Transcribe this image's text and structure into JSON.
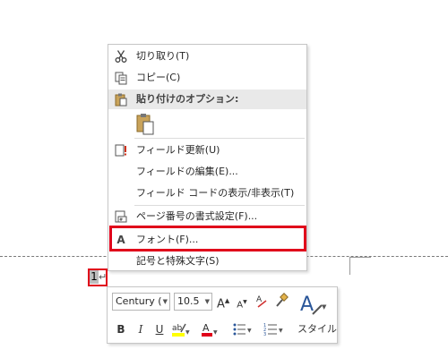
{
  "menu": {
    "items": [
      {
        "label": "切り取り(T)",
        "icon": "scissors-icon"
      },
      {
        "label": "コピー(C)",
        "icon": "copy-icon"
      },
      {
        "label": "貼り付けのオプション:",
        "icon": "paste-icon"
      },
      {
        "label": "フィールド更新(U)",
        "icon": "update-field-icon"
      },
      {
        "label": "フィールドの編集(E)...",
        "icon": ""
      },
      {
        "label": "フィールド コードの表示/非表示(T)",
        "icon": ""
      },
      {
        "label": "ページ番号の書式設定(F)...",
        "icon": "page-number-format-icon"
      },
      {
        "label": "フォント(F)...",
        "icon": "font-icon"
      },
      {
        "label": "記号と特殊文字(S)",
        "icon": ""
      }
    ]
  },
  "document": {
    "page_number": "1",
    "paragraph_mark": "↵"
  },
  "toolbar": {
    "font_name": "Century (",
    "font_size": "10.5",
    "grow_font": "A",
    "shrink_font": "A",
    "bold": "B",
    "italic": "I",
    "underline": "U",
    "style_label": "スタイル",
    "font_icon_glyph": "A"
  },
  "colors": {
    "highlight_border": "#e0001a",
    "font_color": "#e0001a",
    "highlighter": "#ffff00",
    "style_accent": "#2b579a"
  }
}
